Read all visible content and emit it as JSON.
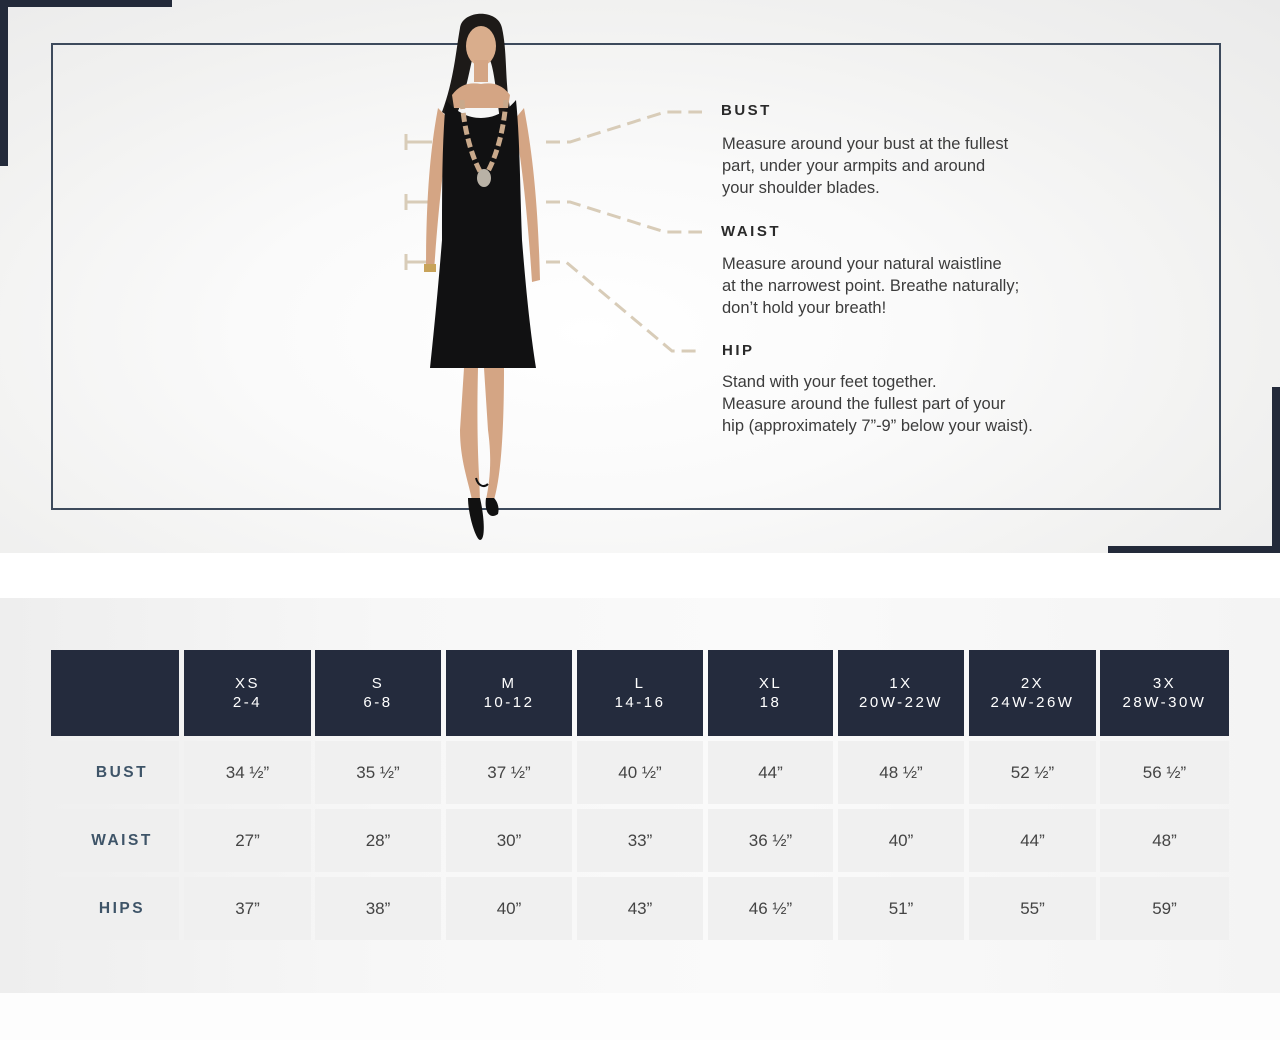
{
  "guide": {
    "bust": {
      "heading": "BUST",
      "text": "Measure around your bust at the fullest\npart, under your armpits and around\nyour shoulder blades."
    },
    "waist": {
      "heading": "WAIST",
      "text": "Measure around your natural waistline\nat the narrowest point. Breathe naturally;\ndon’t hold your breath!"
    },
    "hip": {
      "heading": "HIP",
      "text": "Stand with your feet together.\nMeasure around the fullest part of your\nhip (approximately 7”-9” below your waist)."
    }
  },
  "size_table": {
    "sizes": [
      {
        "letter": "XS",
        "numeric": "2-4"
      },
      {
        "letter": "S",
        "numeric": "6-8"
      },
      {
        "letter": "M",
        "numeric": "10-12"
      },
      {
        "letter": "L",
        "numeric": "14-16"
      },
      {
        "letter": "XL",
        "numeric": "18"
      },
      {
        "letter": "1X",
        "numeric": "20W-22W"
      },
      {
        "letter": "2X",
        "numeric": "24W-26W"
      },
      {
        "letter": "3X",
        "numeric": "28W-30W"
      }
    ],
    "rows": [
      {
        "label": "BUST",
        "values": [
          "34 ½”",
          "35 ½”",
          "37 ½”",
          "40 ½”",
          "44”",
          "48 ½”",
          "52 ½”",
          "56 ½”"
        ]
      },
      {
        "label": "WAIST",
        "values": [
          "27”",
          "28”",
          "30”",
          "33”",
          "36 ½”",
          "40”",
          "44”",
          "48”"
        ]
      },
      {
        "label": "HIPS",
        "values": [
          "37”",
          "38”",
          "40”",
          "43”",
          "46 ½”",
          "51”",
          "55”",
          "59”"
        ]
      }
    ]
  },
  "colors": {
    "header_navy": "#242b3d",
    "accent_frame": "#3d4a5c",
    "guide_line": "#d8ccb8"
  }
}
